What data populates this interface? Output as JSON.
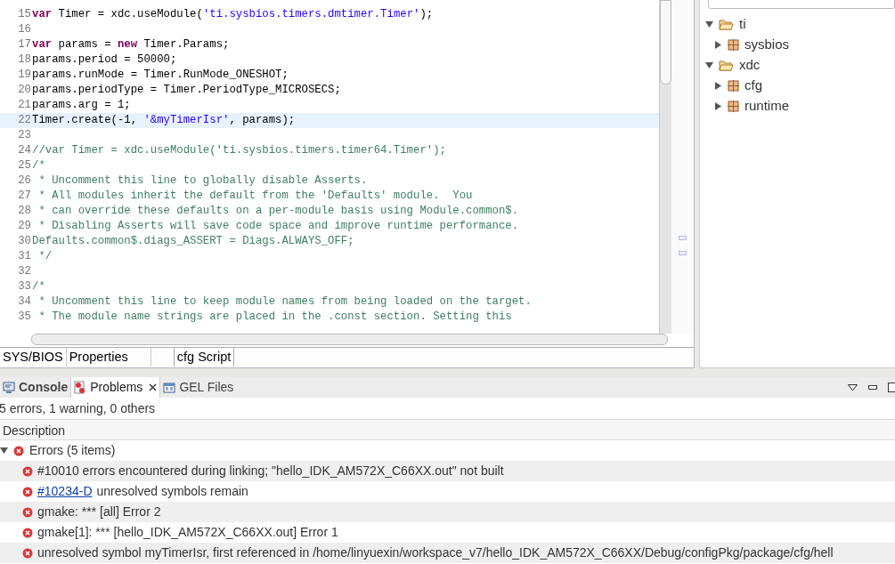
{
  "editor": {
    "lines": [
      {
        "number": "15",
        "highlighted": false,
        "segments": [
          {
            "kind": "keyword",
            "text": "var"
          },
          {
            "kind": "plain",
            "text": " Timer = xdc.useModule("
          },
          {
            "kind": "string",
            "text": "'ti.sysbios.timers.dmtimer.Timer'"
          },
          {
            "kind": "plain",
            "text": ");"
          }
        ]
      },
      {
        "number": "16",
        "highlighted": false
      },
      {
        "number": "17",
        "highlighted": false,
        "segments": [
          {
            "kind": "keyword",
            "text": "var"
          },
          {
            "kind": "plain",
            "text": " params = "
          },
          {
            "kind": "keyword",
            "text": "new"
          },
          {
            "kind": "plain",
            "text": " Timer.Params;"
          }
        ]
      },
      {
        "number": "18",
        "highlighted": false,
        "segments": [
          {
            "kind": "plain",
            "text": "params.period = 50000;"
          }
        ]
      },
      {
        "number": "19",
        "highlighted": false,
        "segments": [
          {
            "kind": "plain",
            "text": "params.runMode = Timer.RunMode_ONESHOT;"
          }
        ]
      },
      {
        "number": "20",
        "highlighted": false,
        "segments": [
          {
            "kind": "plain",
            "text": "params.periodType = Timer.PeriodType_MICROSECS;"
          }
        ]
      },
      {
        "number": "21",
        "highlighted": false,
        "segments": [
          {
            "kind": "plain",
            "text": "params.arg = 1;"
          }
        ]
      },
      {
        "number": "22",
        "highlighted": true,
        "segments": [
          {
            "kind": "plain",
            "text": "Timer.create(-1, "
          },
          {
            "kind": "string",
            "text": "'&myTimerIsr'"
          },
          {
            "kind": "plain",
            "text": ", params);"
          }
        ]
      },
      {
        "number": "23",
        "highlighted": false
      },
      {
        "number": "24",
        "highlighted": false,
        "segments": [
          {
            "kind": "comment",
            "text": "//var Timer = xdc.useModule('ti.sysbios.timers.timer64.Timer');"
          }
        ]
      },
      {
        "number": "25",
        "highlighted": false,
        "segments": [
          {
            "kind": "comment",
            "text": "/*"
          }
        ]
      },
      {
        "number": "26",
        "highlighted": false,
        "segments": [
          {
            "kind": "comment",
            "text": " * Uncomment this line to globally disable Asserts."
          }
        ]
      },
      {
        "number": "27",
        "highlighted": false,
        "segments": [
          {
            "kind": "comment",
            "text": " * All modules inherit the default from the 'Defaults' module.  You"
          }
        ]
      },
      {
        "number": "28",
        "highlighted": false,
        "segments": [
          {
            "kind": "comment",
            "text": " * can override these defaults on a per-module basis using Module.common$."
          }
        ]
      },
      {
        "number": "29",
        "highlighted": false,
        "segments": [
          {
            "kind": "comment",
            "text": " * Disabling Asserts will save code space and improve runtime performance."
          }
        ]
      },
      {
        "number": "30",
        "highlighted": false,
        "segments": [
          {
            "kind": "comment",
            "text": "Defaults.common$.diags_ASSERT = Diags.ALWAYS_OFF;"
          }
        ]
      },
      {
        "number": "31",
        "highlighted": false,
        "segments": [
          {
            "kind": "comment",
            "text": " */"
          }
        ]
      },
      {
        "number": "32",
        "highlighted": false
      },
      {
        "number": "33",
        "highlighted": false,
        "segments": [
          {
            "kind": "comment",
            "text": "/*"
          }
        ]
      },
      {
        "number": "34",
        "highlighted": false,
        "segments": [
          {
            "kind": "comment",
            "text": " * Uncomment this line to keep module names from being loaded on the target."
          }
        ]
      },
      {
        "number": "35",
        "highlighted": false,
        "segments": [
          {
            "kind": "comment",
            "text": " * The module name strings are placed in the .const section. Setting this"
          }
        ]
      }
    ],
    "tabs": [
      {
        "label": "SYS/BIOS",
        "selected": false
      },
      {
        "label": "Properties",
        "selected": false
      },
      {
        "label": "cfg Script",
        "selected": true
      }
    ]
  },
  "outline": {
    "tree": [
      {
        "label": "ti",
        "expanded": true,
        "kind": "folder",
        "children": [
          {
            "label": "sysbios",
            "expanded": false,
            "kind": "package"
          }
        ]
      },
      {
        "label": "xdc",
        "expanded": true,
        "kind": "folder",
        "children": [
          {
            "label": "cfg",
            "expanded": false,
            "kind": "package"
          },
          {
            "label": "runtime",
            "expanded": false,
            "kind": "package"
          }
        ]
      }
    ]
  },
  "problems": {
    "tabs": [
      {
        "label": "Console",
        "selected": false,
        "kind": "console"
      },
      {
        "label": "Problems",
        "selected": true,
        "kind": "problems"
      },
      {
        "label": "GEL Files",
        "selected": false,
        "kind": "gel"
      }
    ],
    "summary": "5 errors, 1 warning, 0 others",
    "column": "Description",
    "group": {
      "label": "Errors (5 items)",
      "expanded": true,
      "items": [
        {
          "text": "#10010 errors encountered during linking; \"hello_IDK_AM572X_C66XX.out\" not built"
        },
        {
          "code": "#10234-D",
          "text": "unresolved symbols remain"
        },
        {
          "text": "gmake: *** [all] Error 2"
        },
        {
          "text": "gmake[1]: *** [hello_IDK_AM572X_C66XX.out] Error 1"
        },
        {
          "text": "unresolved symbol myTimerIsr, first referenced in /home/linyuexin/workspace_v7/hello_IDK_AM572X_C66XX/Debug/configPkg/package/cfg/hell"
        }
      ]
    }
  }
}
